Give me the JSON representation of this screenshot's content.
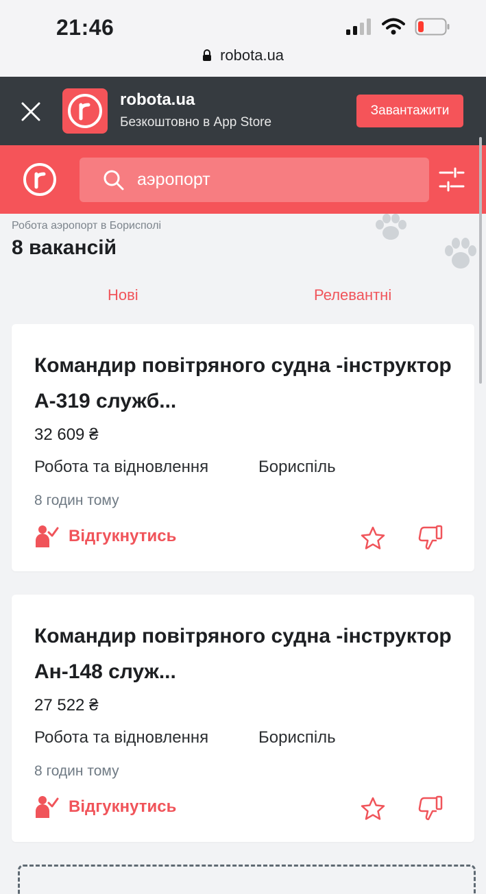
{
  "status_bar": {
    "time": "21:46"
  },
  "browser": {
    "url": "robota.ua"
  },
  "app_banner": {
    "title": "robota.ua",
    "subtitle": "Безкоштовно в App Store",
    "download_label": "Завантажити"
  },
  "search": {
    "query": "аэропорт"
  },
  "results": {
    "breadcrumb": "Робота аэропорт в Борисполі",
    "count": "8 вакансій"
  },
  "sort_tabs": {
    "new": "Нові",
    "relevant": "Релевантні"
  },
  "vacancies": [
    {
      "title": "Командир повітряного судна -інструктор А-319 служб...",
      "salary": "32 609 ₴",
      "company": "Робота та відновлення",
      "city": "Бориспіль",
      "posted": "8 годин тому",
      "apply_label": "Відгукнутись"
    },
    {
      "title": "Командир повітряного судна -інструктор Ан-148 служ...",
      "salary": "27 522 ₴",
      "company": "Робота та відновлення",
      "city": "Бориспіль",
      "posted": "8 годин тому",
      "apply_label": "Відгукнутись"
    }
  ],
  "colors": {
    "brand": "#f55459",
    "banner_bg": "#363b40",
    "page_bg": "#f2f3f5"
  },
  "icons": [
    "lock-icon",
    "close-icon",
    "robota-logo-icon",
    "search-icon",
    "filter-icon",
    "paw-icon",
    "apply-icon",
    "star-icon",
    "dislike-icon"
  ]
}
